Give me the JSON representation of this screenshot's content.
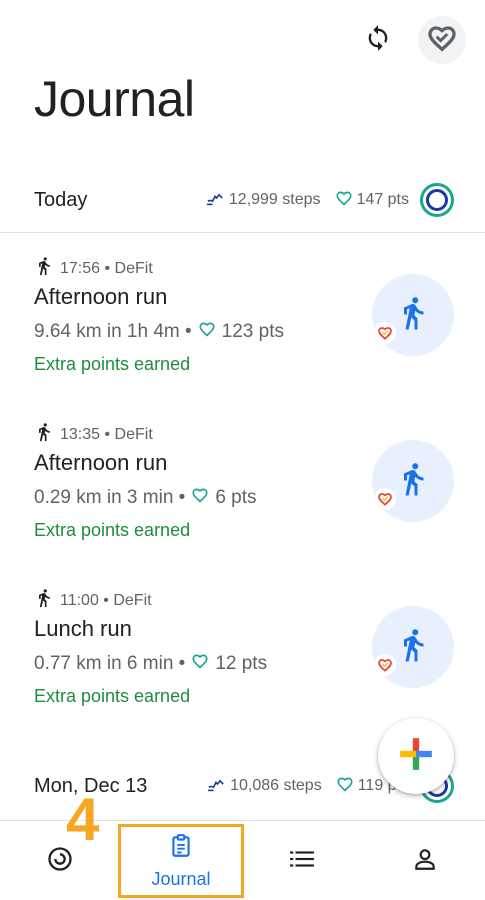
{
  "header": {
    "title": "Journal",
    "sync_icon": "sync-icon",
    "heart_icon": "heart-points-icon"
  },
  "days": [
    {
      "label": "Today",
      "steps": "12,999 steps",
      "points": "147 pts",
      "entries": [
        {
          "time_source": "17:56 • DeFit",
          "title": "Afternoon run",
          "detail": "9.64 km in 1h 4m •",
          "points": "123 pts",
          "extra": "Extra points earned"
        },
        {
          "time_source": "13:35 • DeFit",
          "title": "Afternoon run",
          "detail": "0.29 km in 3 min •",
          "points": "6 pts",
          "extra": "Extra points earned"
        },
        {
          "time_source": "11:00 • DeFit",
          "title": "Lunch run",
          "detail": "0.77 km in 6 min •",
          "points": "12 pts",
          "extra": "Extra points earned"
        }
      ]
    },
    {
      "label": "Mon, Dec 13",
      "steps": "10,086 steps",
      "points": "119 pts"
    }
  ],
  "fab": {
    "icon": "plus-icon"
  },
  "bottom_nav": {
    "home_icon": "home-ring-icon",
    "journal_label": "Journal",
    "journal_icon": "clipboard-icon",
    "browse_icon": "list-icon",
    "profile_icon": "profile-icon"
  },
  "annotation": {
    "step_number": "4"
  },
  "colors": {
    "accent_blue": "#1a73e8",
    "green": "#1e8e3e",
    "teal": "#1aa58d",
    "annotation_orange": "#f5a623"
  }
}
